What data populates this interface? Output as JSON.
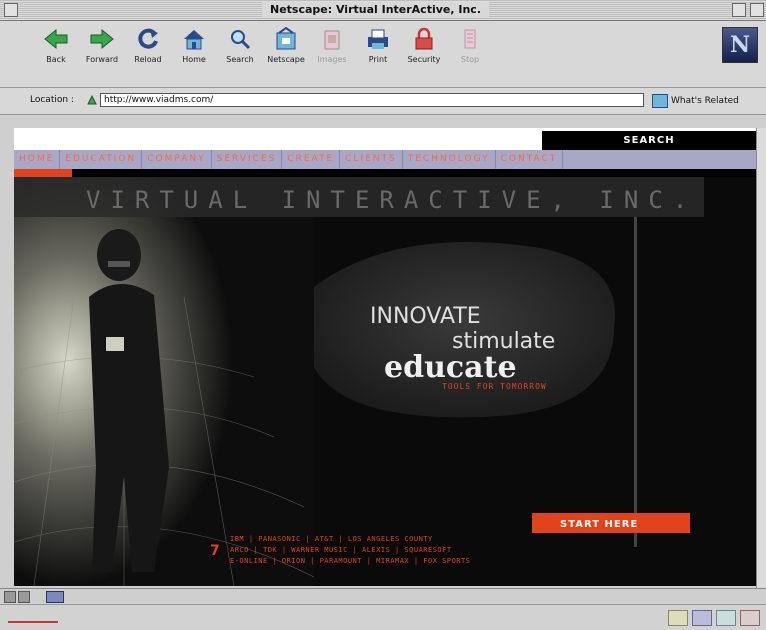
{
  "window": {
    "title": "Netscape: Virtual InterActive, Inc."
  },
  "toolbar": {
    "buttons": [
      {
        "label": "Back",
        "icon": "back-arrow-icon"
      },
      {
        "label": "Forward",
        "icon": "forward-arrow-icon"
      },
      {
        "label": "Reload",
        "icon": "reload-icon"
      },
      {
        "label": "Home",
        "icon": "home-icon"
      },
      {
        "label": "Search",
        "icon": "search-icon"
      },
      {
        "label": "Netscape",
        "icon": "netscape-icon"
      },
      {
        "label": "Images",
        "icon": "images-icon"
      },
      {
        "label": "Print",
        "icon": "print-icon"
      },
      {
        "label": "Security",
        "icon": "security-lock-icon"
      },
      {
        "label": "Stop",
        "icon": "stop-icon"
      }
    ],
    "logo": "N"
  },
  "location": {
    "label": "Location :",
    "url": "http://www.viadms.com/",
    "related": "What's Related"
  },
  "site": {
    "search_tab": "SEARCH",
    "nav": [
      "HOME",
      "EDUCATION",
      "COMPANY",
      "SERVICES",
      "CREATE",
      "CLIENTS",
      "TECHNOLOGY",
      "CONTACT"
    ],
    "banner": "VIRTUAL INTERACTIVE, INC.",
    "tagline": {
      "innovate": "INNOVATE",
      "stimulate": "stimulate",
      "educate": "educate",
      "tools": "TOOLS FOR TOMORROW"
    },
    "start_button": "START HERE",
    "client_marker": "7",
    "clients": [
      "IBM | PANASONIC | AT&T | LOS ANGELES COUNTY",
      "ARCO | TDK | WARNER MUSIC | ALEXIS | SQUARESOFT",
      "E-ONLINE | ORION | PARAMOUNT | MIRAMAX | FOX SPORTS"
    ]
  },
  "colors": {
    "accent": "#e1441c",
    "nav_bar": "#a9a7c7",
    "nav_text": "#ff6a33"
  }
}
